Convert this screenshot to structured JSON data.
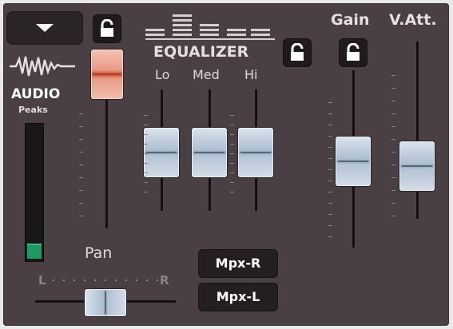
{
  "audio": {
    "title": "AUDIO",
    "subtitle": "Peaks",
    "meter_level": 0.1
  },
  "equalizer": {
    "title": "EQUALIZER",
    "bands": [
      {
        "label": "Lo",
        "level": 0.5
      },
      {
        "label": "Med",
        "level": 0.5
      },
      {
        "label": "Hi",
        "level": 0.5
      }
    ]
  },
  "gain": {
    "label": "Gain",
    "level": 0.5
  },
  "vatt": {
    "label": "V.Att.",
    "level": 0.25
  },
  "pan": {
    "label": "Pan",
    "left": "L",
    "right": "R",
    "value": 0.5
  },
  "outputs": {
    "mpx_r": "Mpx-R",
    "mpx_l": "Mpx-L"
  },
  "icons": {
    "dropdown": "chevron-down-icon",
    "lock": "lock-icon",
    "audio_wave": "audio-waveform-icon",
    "equalizer": "equalizer-icon"
  },
  "colors": {
    "background": "#4a3f43",
    "meter_green": "#1d9a63",
    "fader_red": "#e79a86",
    "fader_blue": "#aebfd0"
  }
}
